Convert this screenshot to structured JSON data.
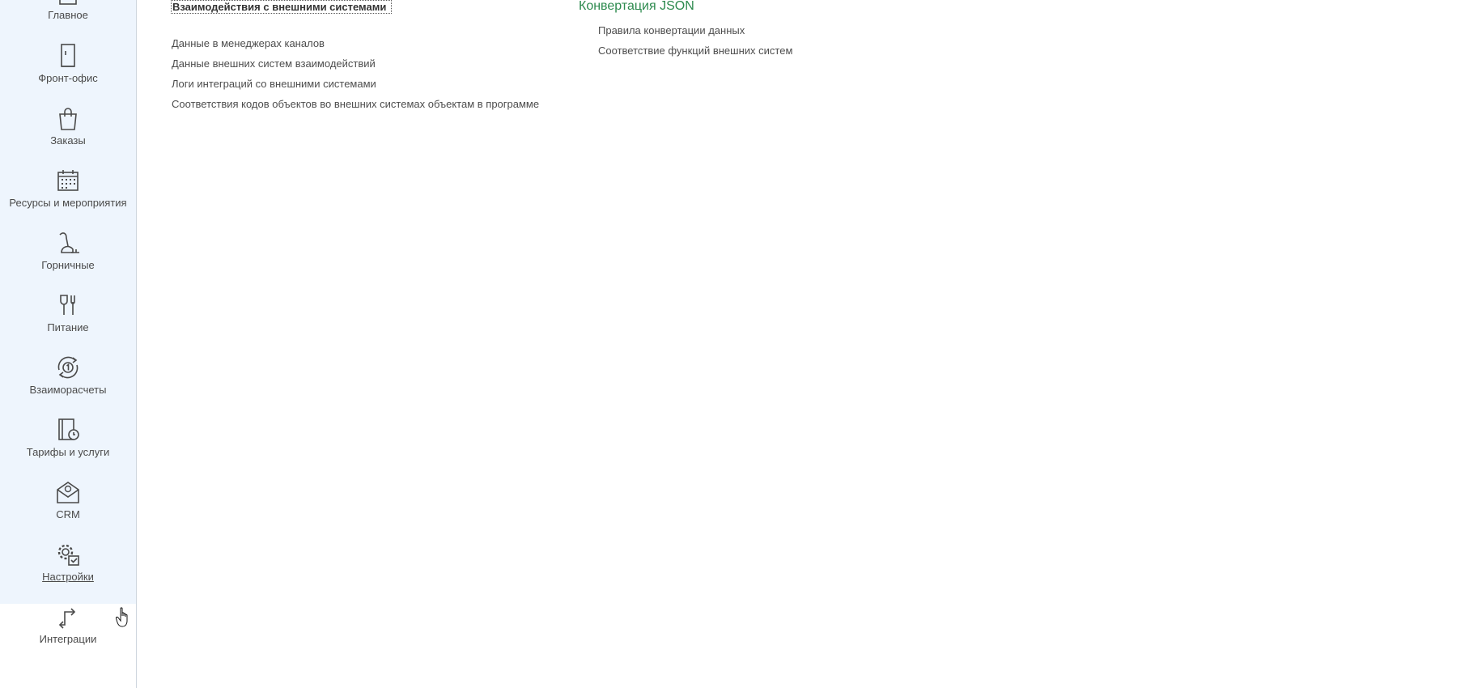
{
  "sidebar": {
    "items": [
      {
        "label": "Главное",
        "icon": "home-icon"
      },
      {
        "label": "Фронт-офис",
        "icon": "door-icon"
      },
      {
        "label": "Заказы",
        "icon": "shopping-bag-icon"
      },
      {
        "label": "Ресурсы и мероприятия",
        "icon": "calendar-icon"
      },
      {
        "label": "Горничные",
        "icon": "vacuum-cleaner-icon"
      },
      {
        "label": "Питание",
        "icon": "food-icon"
      },
      {
        "label": "Взаиморасчеты",
        "icon": "settlement-cycle-icon"
      },
      {
        "label": "Тарифы и услуги",
        "icon": "tariff-icon"
      },
      {
        "label": "CRM",
        "icon": "crm-envelope-icon"
      },
      {
        "label": "Настройки",
        "icon": "settings-gear-icon"
      },
      {
        "label": "Интеграции",
        "icon": "integration-arrows-icon"
      }
    ],
    "active": "Интеграции"
  },
  "main": {
    "section_title": "Взаимодействия с внешними системами",
    "links": [
      "Данные в менеджерах каналов",
      "Данные внешних систем взаимодействий",
      "Логи интеграций со внешними системами",
      "Соответствия кодов объектов во внешних системах объектам в программе"
    ],
    "json_group": {
      "title": "Конвертация JSON",
      "links": [
        "Правила конвертации данных",
        "Соответствие функций внешних систем"
      ]
    }
  },
  "colors": {
    "sidebar_bg": "#eef5fd",
    "group_title": "#2d8a4e",
    "text": "#4d4d4d"
  }
}
